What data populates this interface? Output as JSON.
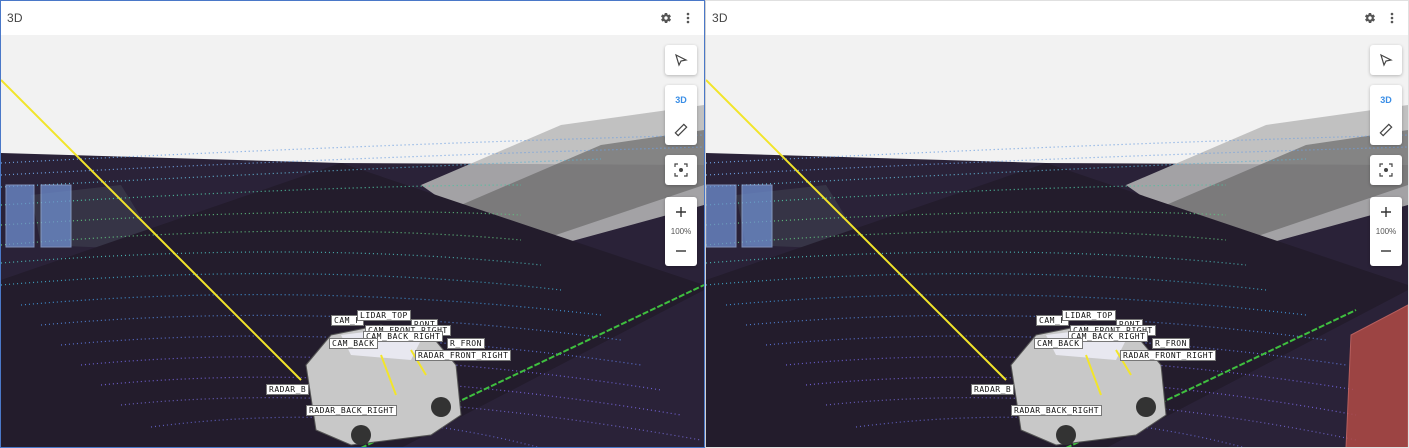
{
  "panels": [
    {
      "title": "3D",
      "toolbar": {
        "settings_icon": "gear-icon",
        "menu_icon": "kebab-menu-icon"
      },
      "controls": {
        "select_icon": "cursor-arrow-icon",
        "mode_label": "3D",
        "measure_icon": "ruler-icon",
        "focus_icon": "focus-target-icon",
        "zoom_in_icon": "plus-icon",
        "zoom_level": "100%",
        "zoom_out_icon": "minus-icon"
      },
      "frame_labels": {
        "cam_front": "CAM_F",
        "lidar_top": "LIDAR_TOP",
        "front": "RONT",
        "cam_front_right": "CAM_FRONT_RIGHT",
        "cam_back_right": "CAM_BACK_RIGHT",
        "cam_back": "CAM_BACK",
        "radar_front_partial": "R_FRON",
        "radar_front_right": "RADAR_FRONT_RIGHT",
        "radar_back": "RADAR_B",
        "radar_back_right": "RADAR_BACK_RIGHT"
      }
    },
    {
      "title": "3D",
      "toolbar": {
        "settings_icon": "gear-icon",
        "menu_icon": "kebab-menu-icon"
      },
      "controls": {
        "select_icon": "cursor-arrow-icon",
        "mode_label": "3D",
        "measure_icon": "ruler-icon",
        "focus_icon": "focus-target-icon",
        "zoom_in_icon": "plus-icon",
        "zoom_level": "100%",
        "zoom_out_icon": "minus-icon"
      },
      "frame_labels": {
        "cam_front": "CAM_F",
        "lidar_top": "LIDAR_TOP",
        "front": "RONT",
        "cam_front_right": "CAM_FRONT_RIGHT",
        "cam_back_right": "CAM_BACK_RIGHT",
        "cam_back": "CAM_BACK",
        "radar_front_partial": "R_FRON",
        "radar_front_right": "RADAR_FRONT_RIGHT",
        "radar_back": "RADAR_B",
        "radar_back_right": "RADAR_BACK_RIGHT"
      }
    }
  ],
  "colors": {
    "accent": "#3a8ee6",
    "sky": "#f2f2f2",
    "ground": "#2a2238",
    "plane": "#231c2c",
    "yellow_ray": "#f2e52a",
    "green_line": "#3fbf3f",
    "red_box": "#b04a45",
    "box_blue": "#6f8fd0"
  }
}
